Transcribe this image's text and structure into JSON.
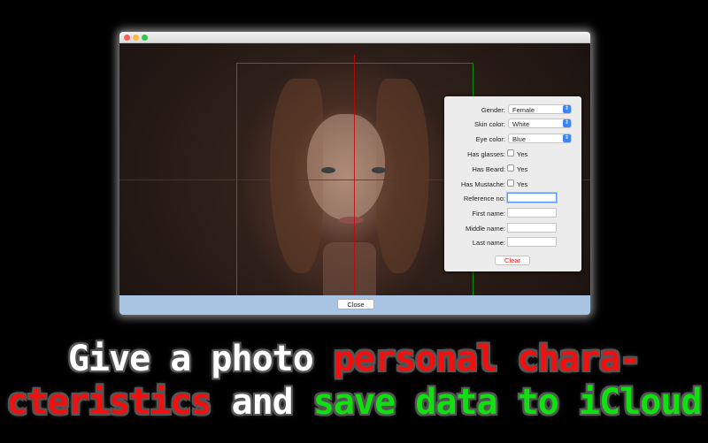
{
  "window": {
    "traffic_lights": [
      "close",
      "minimize",
      "zoom"
    ]
  },
  "form": {
    "gender": {
      "label": "Gender:",
      "value": "Female"
    },
    "skin_color": {
      "label": "Skin color:",
      "value": "White"
    },
    "eye_color": {
      "label": "Eye color:",
      "value": "Blue"
    },
    "has_glasses": {
      "label": "Has glasses:",
      "option": "Yes",
      "checked": false
    },
    "has_beard": {
      "label": "Has Beard:",
      "option": "Yes",
      "checked": false
    },
    "has_mustache": {
      "label": "Has Mustache:",
      "option": "Yes",
      "checked": false
    },
    "reference_no": {
      "label": "Reference no:",
      "value": ""
    },
    "first_name": {
      "label": "First name:",
      "value": ""
    },
    "middle_name": {
      "label": "Middle name:",
      "value": ""
    },
    "last_name": {
      "label": "Last name:",
      "value": ""
    },
    "clear_label": "Clear"
  },
  "footer": {
    "close_label": "Close"
  },
  "caption": {
    "line1_white": "Give a photo ",
    "line1_red": "personal chara-",
    "line2_red": "cteristics",
    "line2_white": " and ",
    "line2_green": "save data to iCloud"
  },
  "colors": {
    "accent_blue": "#3c83f7",
    "clear_red": "#e02020",
    "guide_red": "#d20000",
    "guide_green": "#00b400",
    "caption_red": "#f01010",
    "caption_green": "#10e010"
  }
}
